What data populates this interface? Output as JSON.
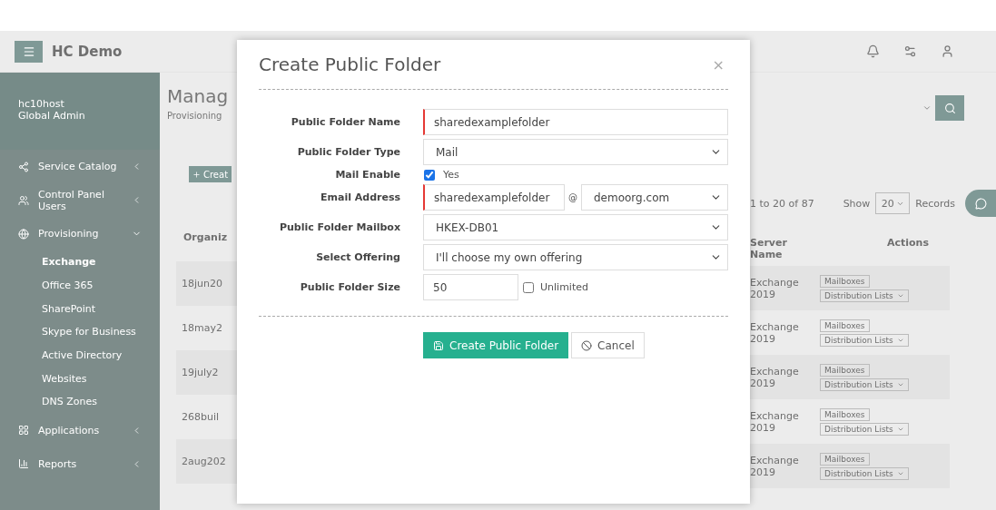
{
  "header": {
    "brand": "HC Demo"
  },
  "sidebar": {
    "user": {
      "name": "hc10host",
      "role": "Global Admin"
    },
    "items": [
      {
        "label": "Service Catalog",
        "expanded": false
      },
      {
        "label": "Control Panel Users",
        "expanded": false
      },
      {
        "label": "Provisioning",
        "expanded": true,
        "children": [
          {
            "label": "Exchange",
            "selected": true
          },
          {
            "label": "Office 365",
            "selected": false
          },
          {
            "label": "SharePoint",
            "selected": false
          },
          {
            "label": "Skype for Business",
            "selected": false
          },
          {
            "label": "Active Directory",
            "selected": false
          },
          {
            "label": "Websites",
            "selected": false
          },
          {
            "label": "DNS Zones",
            "selected": false
          }
        ]
      },
      {
        "label": "Applications",
        "expanded": false
      },
      {
        "label": "Reports",
        "expanded": false
      }
    ]
  },
  "page": {
    "title": "Manag",
    "breadcrumb": "Provisioning",
    "create_button": "Creat",
    "column_1": "Organiz",
    "rows": [
      "18jun20",
      "18may2",
      "19july2",
      "268buil",
      "2aug202"
    ]
  },
  "listing": {
    "record_info": "1 to 20 of 87",
    "show_label": "Show",
    "page_size": "20",
    "records_label": "Records",
    "columns": [
      "Server Name",
      "Actions"
    ],
    "rows": [
      {
        "server": "Exchange 2019",
        "actions": [
          "Mailboxes",
          "Distribution Lists"
        ]
      },
      {
        "server": "Exchange 2019",
        "actions": [
          "Mailboxes",
          "Distribution Lists"
        ]
      },
      {
        "server": "Exchange 2019",
        "actions": [
          "Mailboxes",
          "Distribution Lists"
        ]
      },
      {
        "server": "Exchange 2019",
        "actions": [
          "Mailboxes",
          "Distribution Lists"
        ]
      },
      {
        "server": "Exchange 2019",
        "actions": [
          "Mailboxes",
          "Distribution Lists"
        ]
      }
    ]
  },
  "modal": {
    "title": "Create Public Folder",
    "close": "×",
    "fields": [
      {
        "kind": "text",
        "label": "Public Folder Name",
        "value": "sharedexamplefolder",
        "required": true
      },
      {
        "kind": "select",
        "label": "Public Folder Type",
        "value": "Mail"
      },
      {
        "kind": "checkbox",
        "label": "Mail Enable",
        "option": "Yes",
        "checked": true
      },
      {
        "kind": "email",
        "label": "Email Address",
        "value": "sharedexamplefolder",
        "separator": "@",
        "domain": "demoorg.com",
        "required": true
      },
      {
        "kind": "select",
        "label": "Public Folder Mailbox",
        "value": "HKEX-DB01"
      },
      {
        "kind": "select",
        "label": "Select Offering",
        "value": "I'll choose my own offering"
      },
      {
        "kind": "size",
        "label": "Public Folder Size",
        "value": "50",
        "option": "Unlimited",
        "checked": false
      }
    ],
    "buttons": [
      {
        "kind": "primary",
        "label": "Create Public Folder"
      },
      {
        "kind": "secondary",
        "label": "Cancel"
      }
    ]
  }
}
